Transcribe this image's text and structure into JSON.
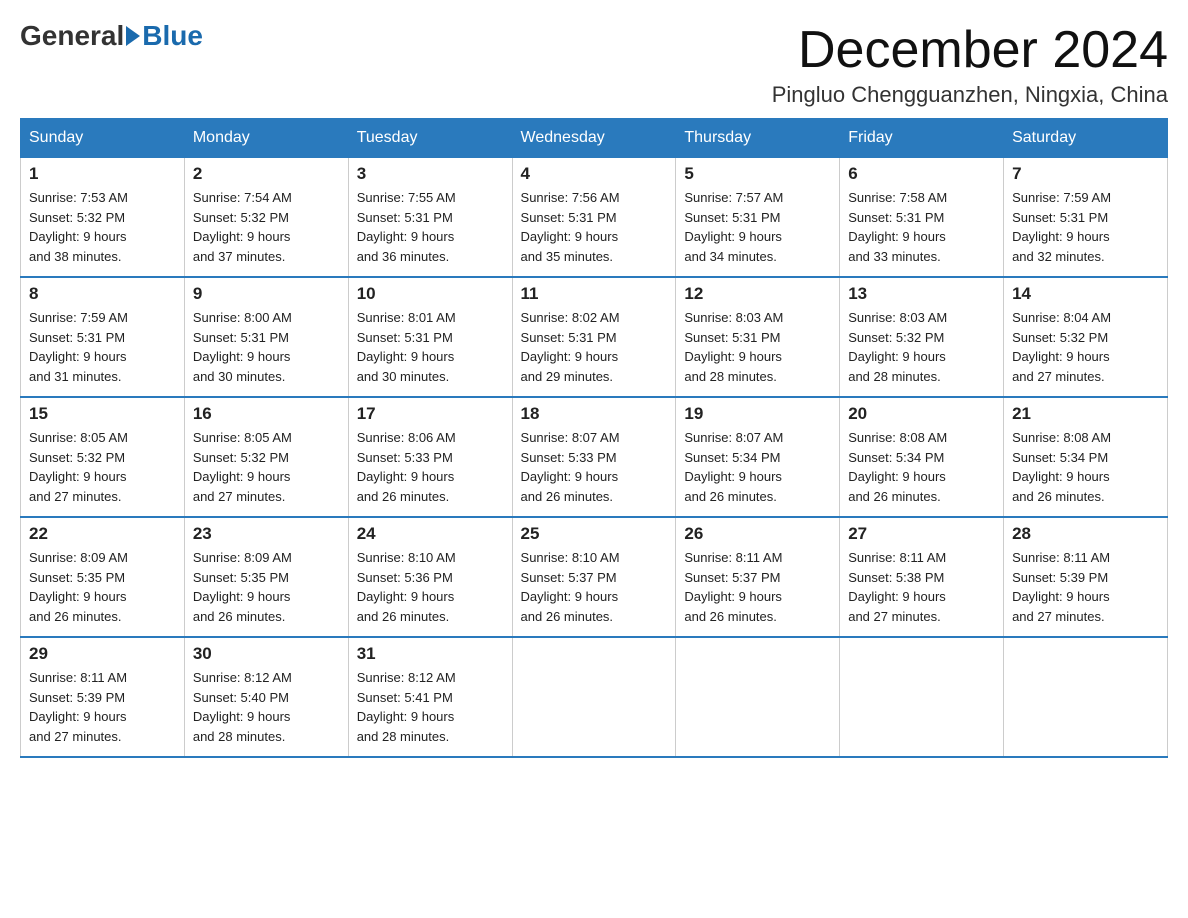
{
  "logo": {
    "general": "General",
    "blue": "Blue"
  },
  "title": "December 2024",
  "location": "Pingluo Chengguanzhen, Ningxia, China",
  "days_of_week": [
    "Sunday",
    "Monday",
    "Tuesday",
    "Wednesday",
    "Thursday",
    "Friday",
    "Saturday"
  ],
  "weeks": [
    [
      {
        "day": "1",
        "sunrise": "7:53 AM",
        "sunset": "5:32 PM",
        "daylight": "9 hours and 38 minutes."
      },
      {
        "day": "2",
        "sunrise": "7:54 AM",
        "sunset": "5:32 PM",
        "daylight": "9 hours and 37 minutes."
      },
      {
        "day": "3",
        "sunrise": "7:55 AM",
        "sunset": "5:31 PM",
        "daylight": "9 hours and 36 minutes."
      },
      {
        "day": "4",
        "sunrise": "7:56 AM",
        "sunset": "5:31 PM",
        "daylight": "9 hours and 35 minutes."
      },
      {
        "day": "5",
        "sunrise": "7:57 AM",
        "sunset": "5:31 PM",
        "daylight": "9 hours and 34 minutes."
      },
      {
        "day": "6",
        "sunrise": "7:58 AM",
        "sunset": "5:31 PM",
        "daylight": "9 hours and 33 minutes."
      },
      {
        "day": "7",
        "sunrise": "7:59 AM",
        "sunset": "5:31 PM",
        "daylight": "9 hours and 32 minutes."
      }
    ],
    [
      {
        "day": "8",
        "sunrise": "7:59 AM",
        "sunset": "5:31 PM",
        "daylight": "9 hours and 31 minutes."
      },
      {
        "day": "9",
        "sunrise": "8:00 AM",
        "sunset": "5:31 PM",
        "daylight": "9 hours and 30 minutes."
      },
      {
        "day": "10",
        "sunrise": "8:01 AM",
        "sunset": "5:31 PM",
        "daylight": "9 hours and 30 minutes."
      },
      {
        "day": "11",
        "sunrise": "8:02 AM",
        "sunset": "5:31 PM",
        "daylight": "9 hours and 29 minutes."
      },
      {
        "day": "12",
        "sunrise": "8:03 AM",
        "sunset": "5:31 PM",
        "daylight": "9 hours and 28 minutes."
      },
      {
        "day": "13",
        "sunrise": "8:03 AM",
        "sunset": "5:32 PM",
        "daylight": "9 hours and 28 minutes."
      },
      {
        "day": "14",
        "sunrise": "8:04 AM",
        "sunset": "5:32 PM",
        "daylight": "9 hours and 27 minutes."
      }
    ],
    [
      {
        "day": "15",
        "sunrise": "8:05 AM",
        "sunset": "5:32 PM",
        "daylight": "9 hours and 27 minutes."
      },
      {
        "day": "16",
        "sunrise": "8:05 AM",
        "sunset": "5:32 PM",
        "daylight": "9 hours and 27 minutes."
      },
      {
        "day": "17",
        "sunrise": "8:06 AM",
        "sunset": "5:33 PM",
        "daylight": "9 hours and 26 minutes."
      },
      {
        "day": "18",
        "sunrise": "8:07 AM",
        "sunset": "5:33 PM",
        "daylight": "9 hours and 26 minutes."
      },
      {
        "day": "19",
        "sunrise": "8:07 AM",
        "sunset": "5:34 PM",
        "daylight": "9 hours and 26 minutes."
      },
      {
        "day": "20",
        "sunrise": "8:08 AM",
        "sunset": "5:34 PM",
        "daylight": "9 hours and 26 minutes."
      },
      {
        "day": "21",
        "sunrise": "8:08 AM",
        "sunset": "5:34 PM",
        "daylight": "9 hours and 26 minutes."
      }
    ],
    [
      {
        "day": "22",
        "sunrise": "8:09 AM",
        "sunset": "5:35 PM",
        "daylight": "9 hours and 26 minutes."
      },
      {
        "day": "23",
        "sunrise": "8:09 AM",
        "sunset": "5:35 PM",
        "daylight": "9 hours and 26 minutes."
      },
      {
        "day": "24",
        "sunrise": "8:10 AM",
        "sunset": "5:36 PM",
        "daylight": "9 hours and 26 minutes."
      },
      {
        "day": "25",
        "sunrise": "8:10 AM",
        "sunset": "5:37 PM",
        "daylight": "9 hours and 26 minutes."
      },
      {
        "day": "26",
        "sunrise": "8:11 AM",
        "sunset": "5:37 PM",
        "daylight": "9 hours and 26 minutes."
      },
      {
        "day": "27",
        "sunrise": "8:11 AM",
        "sunset": "5:38 PM",
        "daylight": "9 hours and 27 minutes."
      },
      {
        "day": "28",
        "sunrise": "8:11 AM",
        "sunset": "5:39 PM",
        "daylight": "9 hours and 27 minutes."
      }
    ],
    [
      {
        "day": "29",
        "sunrise": "8:11 AM",
        "sunset": "5:39 PM",
        "daylight": "9 hours and 27 minutes."
      },
      {
        "day": "30",
        "sunrise": "8:12 AM",
        "sunset": "5:40 PM",
        "daylight": "9 hours and 28 minutes."
      },
      {
        "day": "31",
        "sunrise": "8:12 AM",
        "sunset": "5:41 PM",
        "daylight": "9 hours and 28 minutes."
      },
      null,
      null,
      null,
      null
    ]
  ],
  "labels": {
    "sunrise": "Sunrise:",
    "sunset": "Sunset:",
    "daylight": "Daylight:"
  }
}
